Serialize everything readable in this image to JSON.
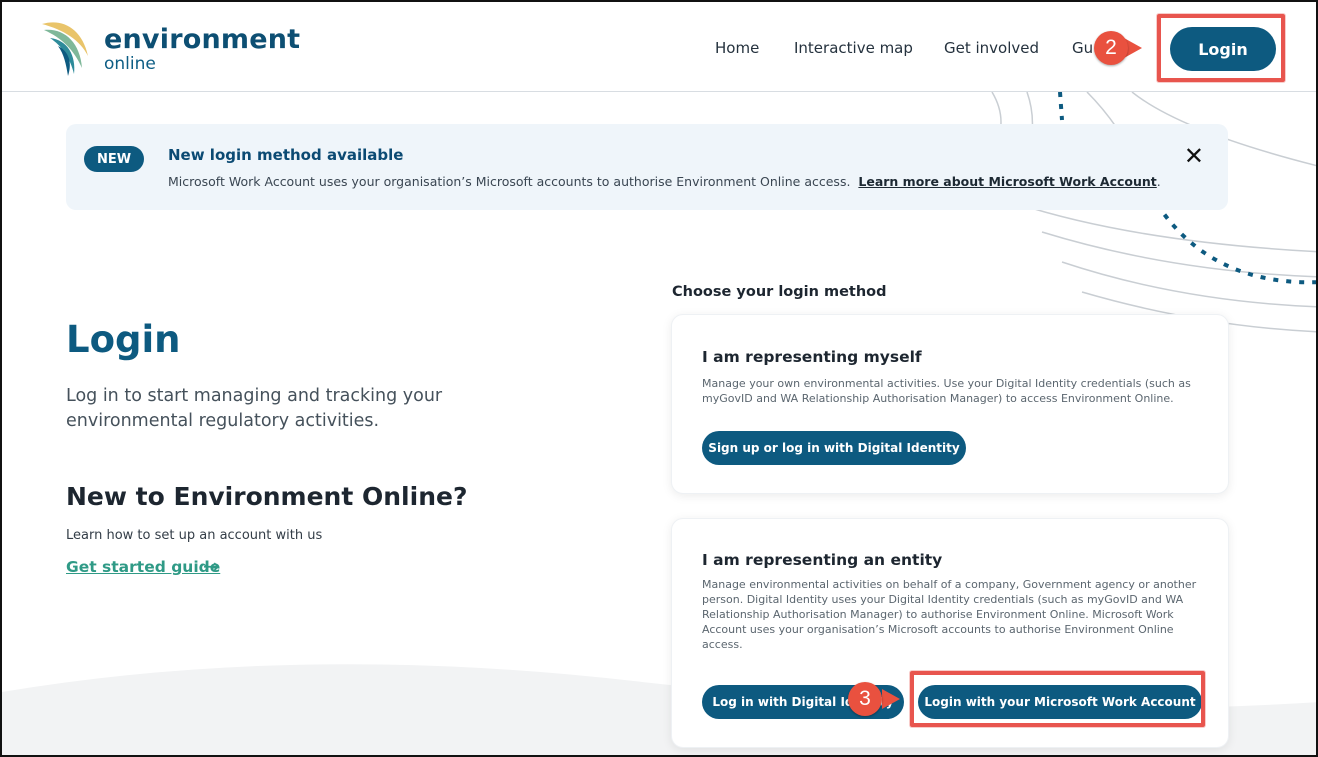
{
  "header": {
    "logo_line1": "environment",
    "logo_line2": "online",
    "nav": [
      "Home",
      "Interactive map",
      "Get involved",
      "Gu"
    ],
    "login_label": "Login"
  },
  "annotations": {
    "step_login": "2",
    "step_microsoft": "3"
  },
  "banner": {
    "badge": "NEW",
    "title": "New login method available",
    "text": "Microsoft Work Account uses your organisation’s Microsoft accounts to authorise Environment Online access.",
    "link": "Learn more about Microsoft Work Account",
    "link_suffix": ".",
    "close_glyph": "✕"
  },
  "main": {
    "title": "Login",
    "subtitle": "Log in to start managing and tracking your environmental regulatory activities.",
    "new_title": "New to Environment Online?",
    "new_sub": "Learn how to set up an account with us",
    "guide_link": "Get started guide",
    "guide_arrow": "→"
  },
  "login_panel": {
    "heading": "Choose your login method",
    "myself": {
      "title": "I am representing myself",
      "text": "Manage your own environmental activities. Use your Digital Identity credentials (such as myGovID and WA Relationship Authorisation Manager) to access Environment Online.",
      "button": "Sign up or log in with Digital Identity"
    },
    "entity": {
      "title": "I am representing an entity",
      "text": "Manage environmental activities on behalf of a company, Government agency or another person. Digital Identity uses your Digital Identity credentials (such as myGovID and WA Relationship Authorisation Manager) to authorise Environment Online. Microsoft Work Account uses your organisation’s Microsoft accounts to authorise Environment Online access.",
      "button_digital": "Log in with Digital Identity",
      "button_microsoft": "Login with your Microsoft Work Account"
    }
  },
  "colors": {
    "brand": "#0d5a80",
    "accent_teal": "#2f9a86",
    "highlight": "#e8554e",
    "banner_bg": "#eff5fa"
  }
}
